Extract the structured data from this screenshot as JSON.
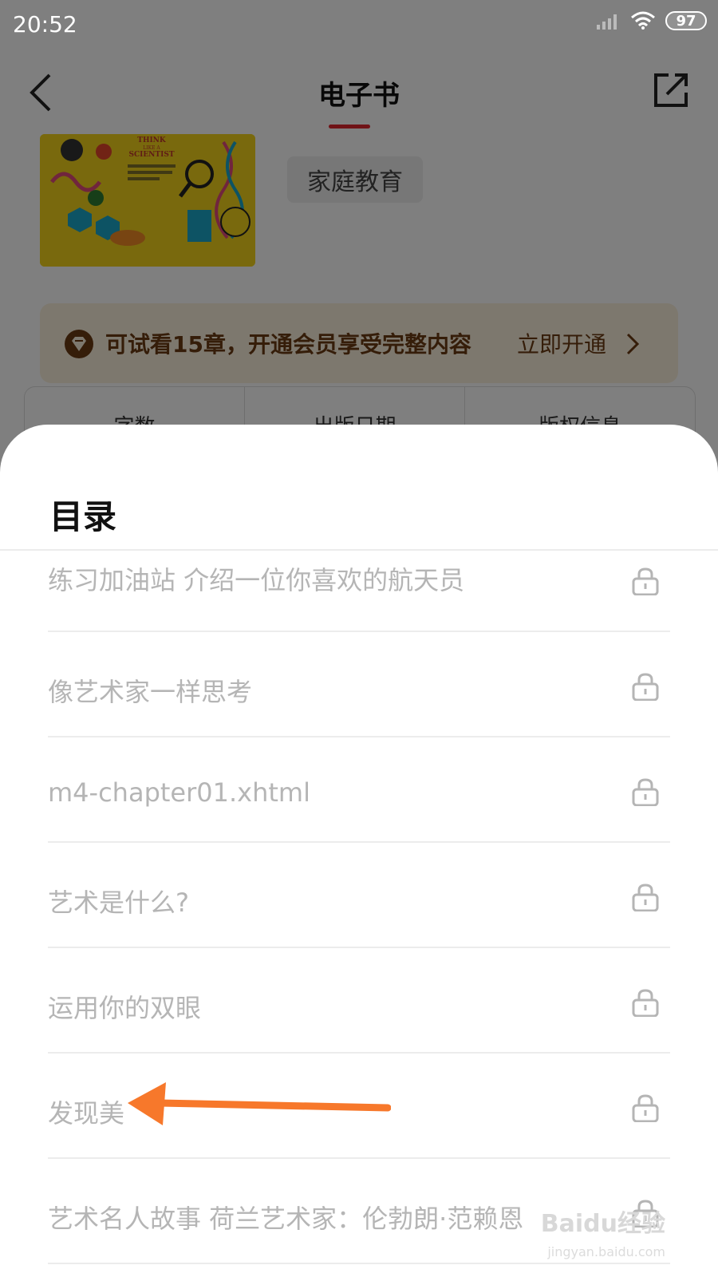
{
  "status_bar": {
    "time": "20:52",
    "battery": "97"
  },
  "nav": {
    "title": "电子书"
  },
  "book": {
    "cover_title_lines": [
      "THINK",
      "LIKE A",
      "SCIENTIST"
    ],
    "tag": "家庭教育"
  },
  "vip_banner": {
    "text": "可试看15章，开通会员享受完整内容",
    "cta": "立即开通"
  },
  "info_columns": [
    "字数",
    "出版日期",
    "版权信息"
  ],
  "toc": {
    "title": "目录",
    "items": [
      {
        "label": "练习加油站 介绍一位你喜欢的航天员",
        "locked": true
      },
      {
        "label": "像艺术家一样思考",
        "locked": true
      },
      {
        "label": "m4-chapter01.xhtml",
        "locked": true
      },
      {
        "label": "艺术是什么?",
        "locked": true
      },
      {
        "label": "运用你的双眼",
        "locked": true
      },
      {
        "label": "发现美",
        "locked": true
      },
      {
        "label": "艺术名人故事 荷兰艺术家：伦勃朗·范赖恩",
        "locked": true
      }
    ]
  },
  "annotation": {
    "arrow_color": "#f7782b"
  },
  "watermark": {
    "logo": "Baidu经验",
    "url": "jingyan.baidu.com"
  },
  "colors": {
    "accent": "#e0262f",
    "vip_brown": "#6b3a12",
    "vip_bg": "#fbf0dd",
    "toc_text": "#b5b5b5"
  }
}
